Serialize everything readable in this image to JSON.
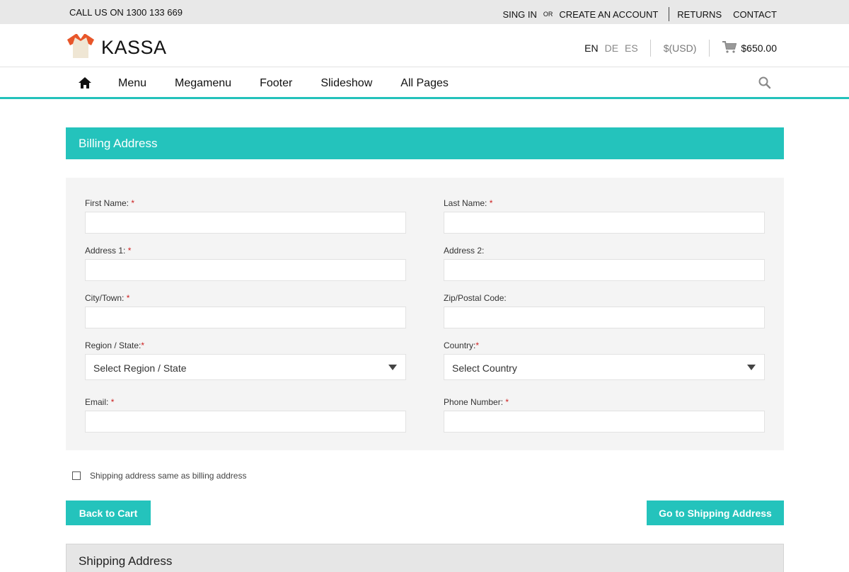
{
  "topbar": {
    "call": "CALL US ON 1300 133 669",
    "sign_in": "SING IN",
    "or": "OR",
    "create_account": "CREATE AN ACCOUNT",
    "returns": "RETURNS",
    "contact": "CONTACT"
  },
  "header": {
    "logo_text": "KASSA",
    "logo_icon": "tshirt-icon",
    "languages": [
      "EN",
      "DE",
      "ES"
    ],
    "active_language": "EN",
    "currency": "$(USD)",
    "cart_total": "$650.00",
    "cart_icon": "cart-icon"
  },
  "nav": {
    "home_icon": "home-icon",
    "items": [
      "Menu",
      "Megamenu",
      "Footer",
      "Slideshow",
      "All Pages"
    ],
    "search_icon": "search-icon"
  },
  "billing": {
    "title": "Billing Address",
    "required_marker": "*",
    "first_name": {
      "label": "First Name:",
      "value": ""
    },
    "last_name": {
      "label": "Last Name:",
      "value": ""
    },
    "address1": {
      "label": "Address 1:",
      "value": ""
    },
    "address2": {
      "label": "Address 2:",
      "value": ""
    },
    "city": {
      "label": "City/Town:",
      "value": ""
    },
    "zip": {
      "label": "Zip/Postal Code:",
      "value": ""
    },
    "region": {
      "label": "Region / State:",
      "selected": "Select Region / State"
    },
    "country": {
      "label": "Country:",
      "selected": "Select Country"
    },
    "email": {
      "label": "Email:",
      "value": ""
    },
    "phone": {
      "label": "Phone Number:",
      "value": ""
    }
  },
  "same_as_billing": {
    "label": "Shipping address same as billing address",
    "checked": false
  },
  "buttons": {
    "back": "Back to Cart",
    "next": "Go to Shipping Address"
  },
  "shipping": {
    "title": "Shipping Address"
  },
  "colors": {
    "accent": "#24c3bc",
    "required": "#cc1f1f"
  }
}
